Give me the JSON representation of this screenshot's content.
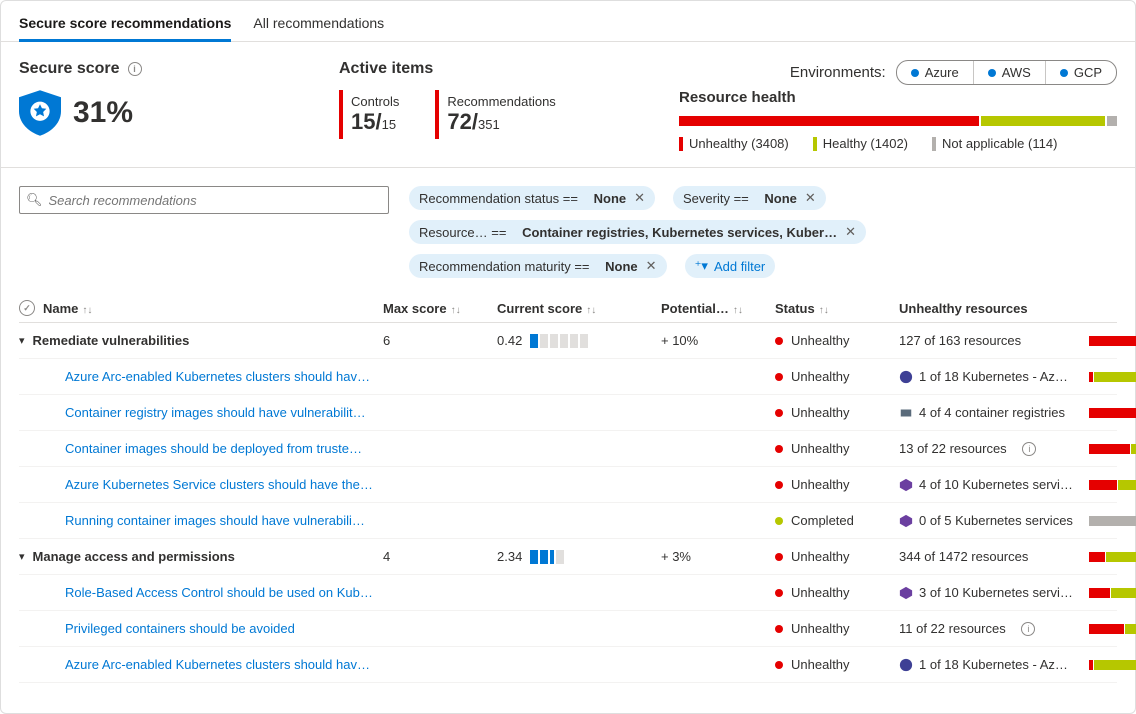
{
  "tabs": {
    "secure": "Secure score recommendations",
    "all": "All recommendations"
  },
  "secure_score": {
    "heading": "Secure score",
    "pct": "31%"
  },
  "active": {
    "heading": "Active items",
    "controls_label": "Controls",
    "controls_cur": "15/",
    "controls_tot": "15",
    "recs_label": "Recommendations",
    "recs_cur": "72/",
    "recs_tot": "351"
  },
  "env": {
    "label": "Environments:",
    "azure": "Azure",
    "aws": "AWS",
    "gcp": "GCP"
  },
  "resource_health": {
    "heading": "Resource health",
    "unhealthy": "Unhealthy (3408)",
    "healthy": "Healthy (1402)",
    "na": "Not applicable (114)"
  },
  "search": {
    "placeholder": "Search recommendations"
  },
  "filters": {
    "rec_status_key": "Recommendation status ==",
    "rec_status_val": "None",
    "severity_key": "Severity ==",
    "severity_val": "None",
    "resource_key": "Resource… ==",
    "resource_val": "Container registries, Kubernetes services, Kuber…",
    "maturity_key": "Recommendation maturity ==",
    "maturity_val": "None",
    "add": "Add filter"
  },
  "columns": {
    "name": "Name",
    "max": "Max score",
    "cur": "Current score",
    "pot": "Potential…",
    "status": "Status",
    "unhealthy": "Unhealthy resources"
  },
  "rows": {
    "g1": {
      "name": "Remediate vulnerabilities",
      "max": "6",
      "cur": "0.42",
      "pot": "+ 10%",
      "status": "Unhealthy",
      "res": "127 of 163 resources"
    },
    "g1c1": {
      "name": "Azure Arc-enabled Kubernetes clusters should hav…",
      "status": "Unhealthy",
      "res": "1 of 18 Kubernetes - Az…"
    },
    "g1c2": {
      "name": "Container registry images should have vulnerabilit…",
      "status": "Unhealthy",
      "res": "4 of 4 container registries"
    },
    "g1c3": {
      "name": "Container images should be deployed from truste…",
      "status": "Unhealthy",
      "res": "13 of 22 resources"
    },
    "g1c4": {
      "name": "Azure Kubernetes Service clusters should have the…",
      "status": "Unhealthy",
      "res": "4 of 10 Kubernetes servi…"
    },
    "g1c5": {
      "name": "Running container images should have vulnerabili…",
      "status": "Completed",
      "res": "0 of 5 Kubernetes services"
    },
    "g2": {
      "name": "Manage access and permissions",
      "max": "4",
      "cur": "2.34",
      "pot": "+ 3%",
      "status": "Unhealthy",
      "res": "344 of 1472 resources"
    },
    "g2c1": {
      "name": "Role-Based Access Control should be used on Kub…",
      "status": "Unhealthy",
      "res": "3 of 10 Kubernetes servi…"
    },
    "g2c2": {
      "name": "Privileged containers should be avoided",
      "status": "Unhealthy",
      "res": "11 of 22 resources"
    },
    "g2c3": {
      "name": "Azure Arc-enabled Kubernetes clusters should hav…",
      "status": "Unhealthy",
      "res": "1 of 18 Kubernetes - Az…"
    }
  }
}
